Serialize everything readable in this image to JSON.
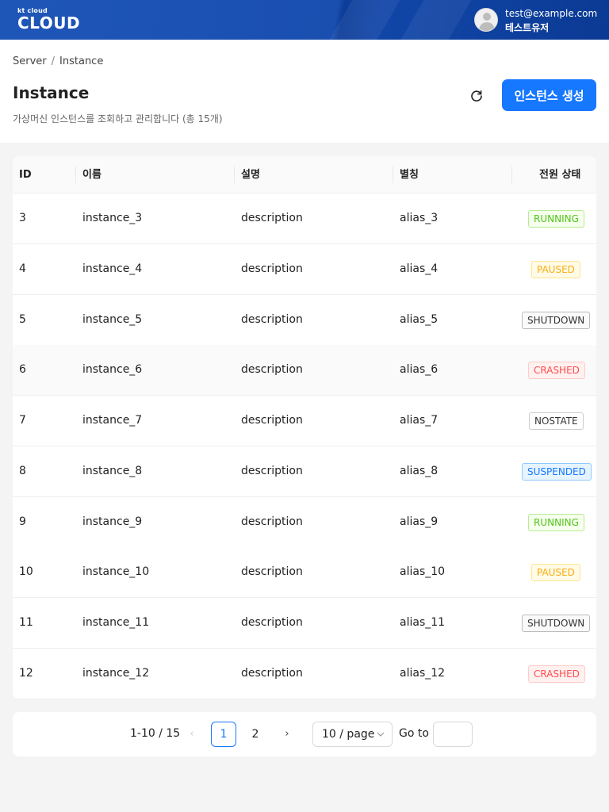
{
  "brand": {
    "small": "kt cloud",
    "big": "CLOUD"
  },
  "user": {
    "email": "test@example.com",
    "name": "테스트유저",
    "avatar_icon": "user-avatar-icon"
  },
  "breadcrumb": {
    "items": [
      "Server",
      "Instance"
    ],
    "separator": "/"
  },
  "page": {
    "title": "Instance",
    "description": "가상머신 인스턴스를 조회하고 관리합니다 (총 15개)",
    "refresh_icon": "refresh-icon",
    "create_button": "인스턴스 생성"
  },
  "colors": {
    "primary": "#1677ff",
    "header_bg": "#1a4fb0"
  },
  "table": {
    "columns": [
      "ID",
      "이름",
      "설명",
      "별칭",
      "전원 상태"
    ],
    "rows": [
      {
        "id": "3",
        "name": "instance_3",
        "desc": "description",
        "alias": "alias_3",
        "status": "RUNNING"
      },
      {
        "id": "4",
        "name": "instance_4",
        "desc": "description",
        "alias": "alias_4",
        "status": "PAUSED"
      },
      {
        "id": "5",
        "name": "instance_5",
        "desc": "description",
        "alias": "alias_5",
        "status": "SHUTDOWN"
      },
      {
        "id": "6",
        "name": "instance_6",
        "desc": "description",
        "alias": "alias_6",
        "status": "CRASHED"
      },
      {
        "id": "7",
        "name": "instance_7",
        "desc": "description",
        "alias": "alias_7",
        "status": "NOSTATE"
      },
      {
        "id": "8",
        "name": "instance_8",
        "desc": "description",
        "alias": "alias_8",
        "status": "SUSPENDED"
      },
      {
        "id": "9",
        "name": "instance_9",
        "desc": "description",
        "alias": "alias_9",
        "status": "RUNNING"
      },
      {
        "id": "10",
        "name": "instance_10",
        "desc": "description",
        "alias": "alias_10",
        "status": "PAUSED"
      },
      {
        "id": "11",
        "name": "instance_11",
        "desc": "description",
        "alias": "alias_11",
        "status": "SHUTDOWN"
      },
      {
        "id": "12",
        "name": "instance_12",
        "desc": "description",
        "alias": "alias_12",
        "status": "CRASHED"
      }
    ]
  },
  "pagination": {
    "total_text": "1-10 / 15",
    "pages": [
      "1",
      "2"
    ],
    "current_page": "1",
    "page_size": "10 / page",
    "goto_label": "Go to",
    "goto_value": ""
  }
}
